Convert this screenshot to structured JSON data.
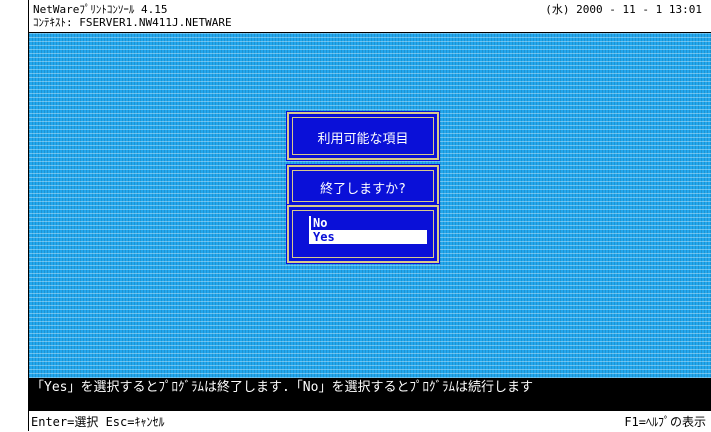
{
  "header": {
    "title": "NetWareﾌﾟﾘﾝﾄｺﾝｿｰﾙ  4.15",
    "context": "ｺﾝﾃｷｽﾄ: FSERVER1.NW411J.NETWARE",
    "datetime": "(水)  2000 - 11 - 1  13:01"
  },
  "dialog": {
    "available_items_title": "利用可能な項目",
    "confirm_title": "終了しますか?",
    "options": [
      "No",
      "Yes"
    ],
    "selected": "Yes"
  },
  "status": {
    "message": "「Yes」を選択するとﾌﾟﾛｸﾞﾗﾑは終了します.「No」を選択するとﾌﾟﾛｸﾞﾗﾑは続行します"
  },
  "footer": {
    "left": "Enter=選択   Esc=ｷｬﾝｾﾙ",
    "right": "F1=ﾍﾙﾌﾟの表示"
  },
  "colors": {
    "background": "#22a7ee",
    "dialog": "#0a10d8",
    "dialog_border": "#d9c98a"
  }
}
